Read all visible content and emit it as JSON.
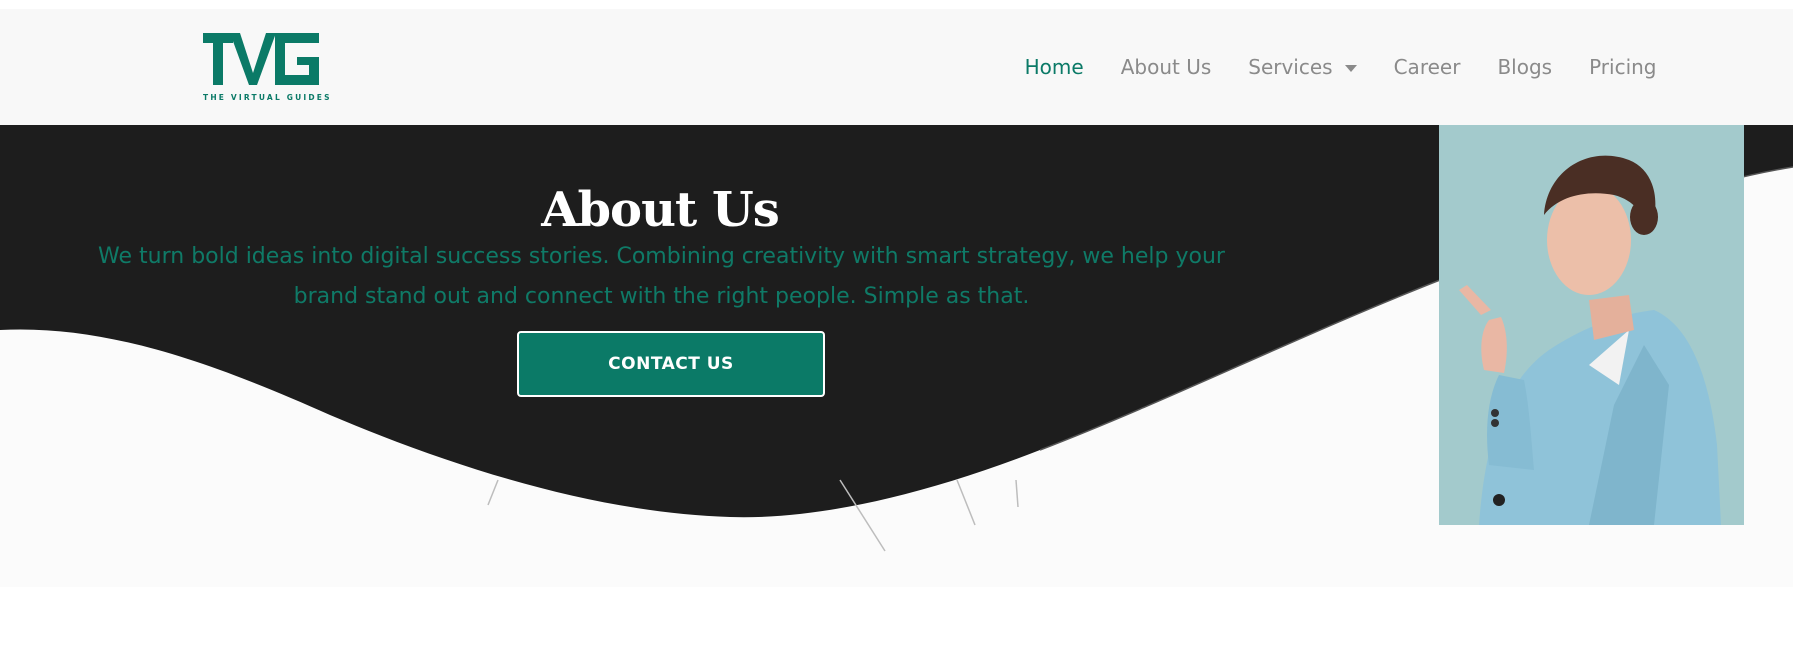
{
  "brand": {
    "logo_text": "TVG",
    "tagline": "THE VIRTUAL GUIDES",
    "color": "#0b7a67"
  },
  "nav": {
    "items": [
      {
        "label": "Home",
        "active": true
      },
      {
        "label": "About Us",
        "active": false
      },
      {
        "label": "Services",
        "active": false,
        "dropdown": true
      },
      {
        "label": "Career",
        "active": false
      },
      {
        "label": "Blogs",
        "active": false
      },
      {
        "label": "Pricing",
        "active": false
      }
    ]
  },
  "hero": {
    "title": "About Us",
    "line1": "We turn bold ideas into digital success stories. Combining creativity with smart strategy, we help your",
    "line2": "brand stand out and connect with the right people. Simple as that.",
    "cta_label": "CONTACT US",
    "image": "portrait-woman-pointing",
    "colors": {
      "dark": "#1d1d1d",
      "accent": "#0b7a67",
      "text": "#0f7a67"
    }
  }
}
